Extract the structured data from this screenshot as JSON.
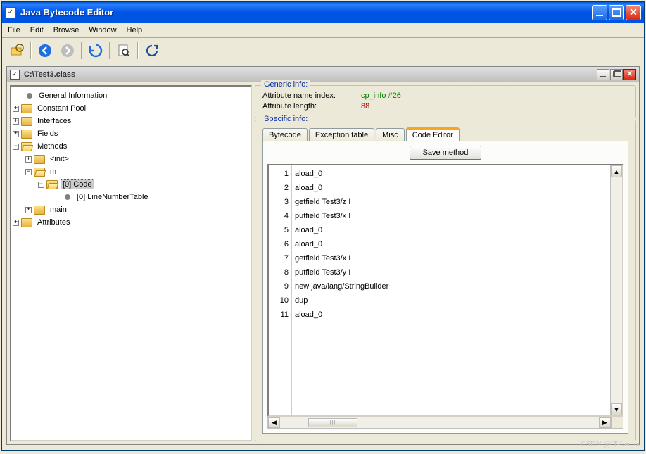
{
  "window": {
    "title": "Java Bytecode Editor"
  },
  "menu": {
    "items": [
      "File",
      "Edit",
      "Browse",
      "Window",
      "Help"
    ]
  },
  "toolbar": {
    "icons": [
      "open-file-icon",
      "back-icon",
      "forward-icon",
      "refresh-icon",
      "search-file-icon",
      "reload-icon"
    ]
  },
  "subwindow": {
    "title": "C:\\Test3.class"
  },
  "tree": {
    "root": [
      {
        "label": "General Information",
        "leaf": true
      },
      {
        "label": "Constant Pool",
        "exp": "+"
      },
      {
        "label": "Interfaces",
        "exp": "+"
      },
      {
        "label": "Fields",
        "exp": "+"
      },
      {
        "label": "Methods",
        "exp": "-",
        "children": [
          {
            "label": "<init>",
            "exp": "+"
          },
          {
            "label": "m",
            "exp": "-",
            "children": [
              {
                "label": "[0] Code",
                "exp": "-",
                "selected": true,
                "children": [
                  {
                    "label": "[0] LineNumberTable",
                    "leaf": true
                  }
                ]
              }
            ]
          },
          {
            "label": "main",
            "exp": "+"
          }
        ]
      },
      {
        "label": "Attributes",
        "exp": "+"
      }
    ]
  },
  "generic_info": {
    "legend": "Generic info:",
    "attr_name_label": "Attribute name index:",
    "attr_name_value": "cp_info #26",
    "attr_len_label": "Attribute length:",
    "attr_len_value": "88"
  },
  "specific_info": {
    "legend": "Specific info:",
    "tabs": [
      "Bytecode",
      "Exception table",
      "Misc",
      "Code Editor"
    ],
    "active_tab": 3,
    "save_label": "Save method",
    "code": [
      "aload_0",
      "aload_0",
      "getfield Test3/z I",
      "putfield Test3/x I",
      "aload_0",
      "aload_0",
      "getfield Test3/x I",
      "putfield Test3/y I",
      "new java/lang/StringBuilder",
      "dup",
      "aload_0"
    ]
  },
  "watermark": "CSDN @IT-Lenjor"
}
